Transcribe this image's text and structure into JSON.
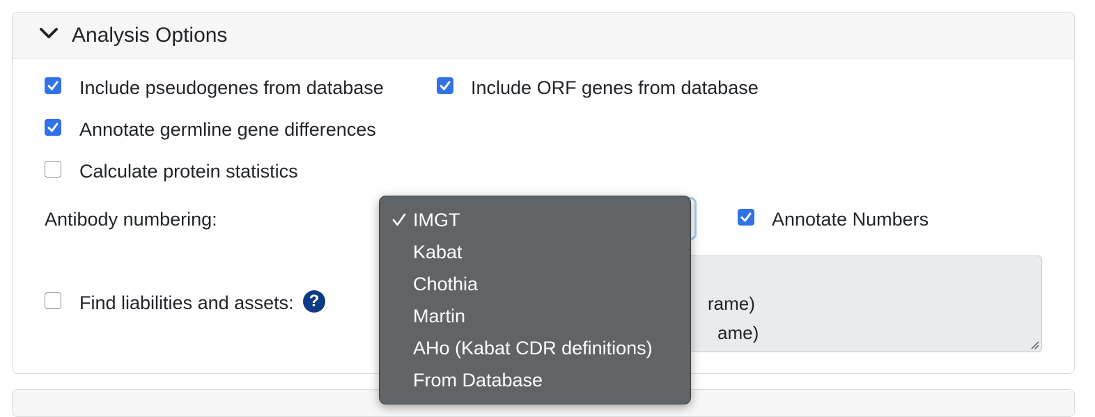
{
  "panel": {
    "title": "Analysis Options"
  },
  "options": {
    "pseudogenes": {
      "label": "Include pseudogenes from database",
      "checked": true
    },
    "orf_genes": {
      "label": "Include ORF genes from database",
      "checked": true
    },
    "germline_diff": {
      "label": "Annotate germline gene differences",
      "checked": true
    },
    "protein_stats": {
      "label": "Calculate protein statistics",
      "checked": false
    },
    "annotate_numbers": {
      "label": "Annotate Numbers",
      "checked": true
    },
    "liabilities": {
      "label": "Find liabilities and assets:",
      "checked": false
    }
  },
  "numbering": {
    "label": "Antibody numbering:",
    "selected": "IMGT",
    "options": [
      "IMGT",
      "Kabat",
      "Chothia",
      "Martin",
      "AHo (Kabat CDR definitions)",
      "From Database"
    ]
  },
  "liabilities_textarea": {
    "line1": "rame)",
    "line2": "ame)"
  },
  "help": {
    "glyph": "?"
  },
  "colors": {
    "accent": "#2f73e6",
    "dropdown_bg": "#616467",
    "help_icon": "#0d3a84"
  },
  "icons": {
    "collapse": "chevron-down-icon",
    "help": "help-icon",
    "selected": "checkmark-icon"
  }
}
